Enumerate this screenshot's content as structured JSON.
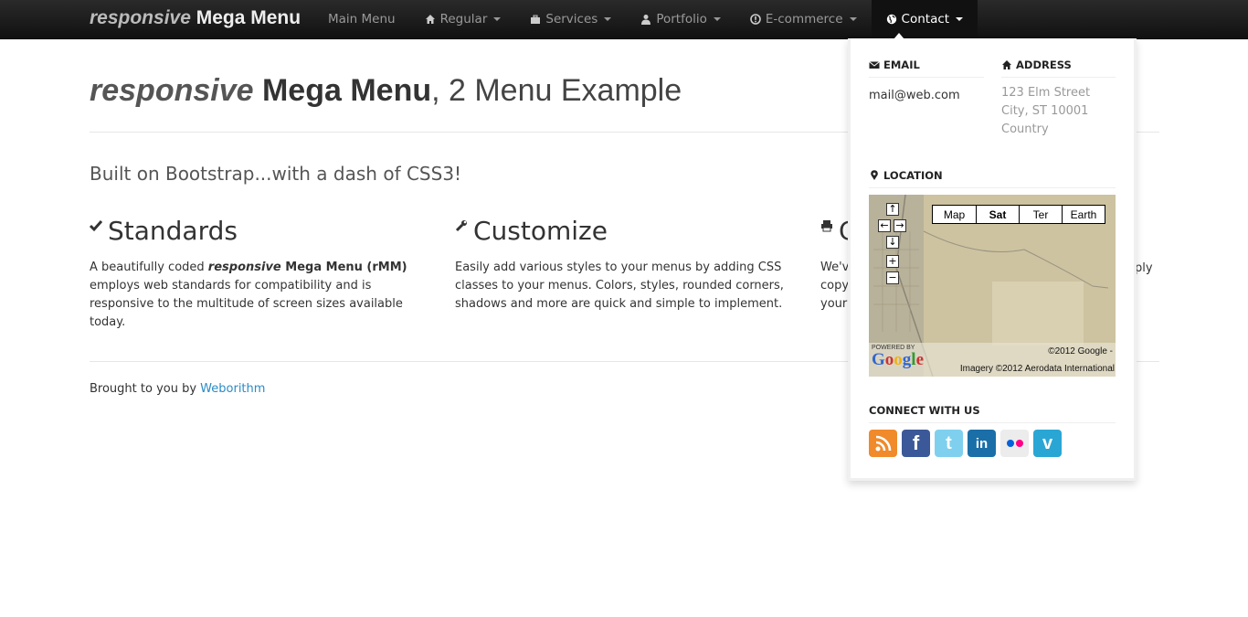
{
  "brand": {
    "italic": "responsive",
    "bold": "Mega Menu"
  },
  "nav": {
    "items": [
      {
        "label": "Main Menu",
        "icon": ""
      },
      {
        "label": "Regular",
        "icon": "home-icon"
      },
      {
        "label": "Services",
        "icon": "briefcase-icon"
      },
      {
        "label": "Portfolio",
        "icon": "user-icon"
      },
      {
        "label": "E-commerce",
        "icon": "info-icon"
      },
      {
        "label": "Contact",
        "icon": "globe-icon"
      }
    ]
  },
  "page": {
    "title_italic": "responsive",
    "title_bold": "Mega Menu",
    "title_rest": ", 2 Menu Example",
    "lead": "Built on Bootstrap...with a dash of CSS3!"
  },
  "columns": [
    {
      "heading": "Standards",
      "icon": "check-icon",
      "text_pre": "A beautifully coded ",
      "text_italic": "responsive",
      "text_bold": " Mega Menu (rMM)",
      "text_post": " employs web standards for compatibility and is responsive to the multitude of screen sizes available today."
    },
    {
      "heading": "Customize",
      "icon": "wrench-icon",
      "text": "Easily add various styles to your menus by adding CSS classes to your menus. Colors, styles, rounded corners, shadows and more are quick and simple to implement."
    },
    {
      "heading": "C",
      "icon": "print-icon",
      "text_line1": "We'v",
      "text_line2": "copy",
      "text_line3": "your",
      "text_right": "ply"
    }
  ],
  "footer": {
    "text": "Brought to you by ",
    "link": "Weborithm"
  },
  "dropdown": {
    "email_heading": "EMAIL",
    "email": "mail@web.com",
    "address_heading": "ADDRESS",
    "address_line1": "123 Elm Street",
    "address_line2": "City, ST 10001",
    "address_line3": "Country",
    "location_heading": "LOCATION",
    "map": {
      "types": [
        "Map",
        "Sat",
        "Ter",
        "Earth"
      ],
      "selected": "Sat",
      "copyright1": "©2012 Google -",
      "copyright2": "Imagery ©2012 Aerodata International",
      "powered": "POWERED BY",
      "logo": "Google"
    },
    "connect_heading": "CONNECT WITH US",
    "social": [
      {
        "name": "rss-icon",
        "color": "#f08a2a"
      },
      {
        "name": "facebook-icon",
        "color": "#3b5998"
      },
      {
        "name": "twitter-icon",
        "color": "#5ec4ea"
      },
      {
        "name": "linkedin-icon",
        "color": "#1a6fa8"
      },
      {
        "name": "flickr-icon",
        "color": "#e8e8e8"
      },
      {
        "name": "vimeo-icon",
        "color": "#2aa6d4"
      }
    ]
  }
}
